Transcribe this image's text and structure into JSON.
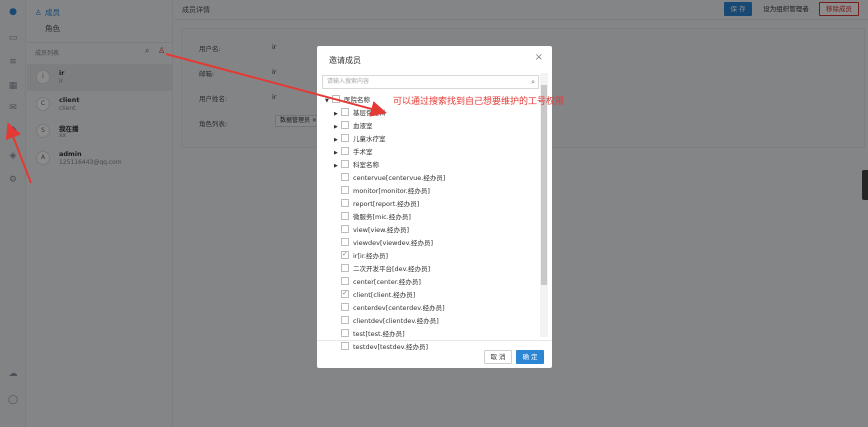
{
  "rail": {
    "icons": [
      "app-logo-icon",
      "monitor-icon",
      "list-icon",
      "grid-icon",
      "message-icon",
      "users-icon",
      "shield-icon",
      "gear-icon",
      "cloud-upload-icon",
      "user-icon"
    ]
  },
  "left": {
    "tabs": [
      {
        "label": "成员"
      },
      {
        "label": "角色"
      }
    ],
    "members_title": "成员列表",
    "members": [
      {
        "avatar": "i",
        "name": "ir",
        "sub": "ir"
      },
      {
        "avatar": "C",
        "name": "client",
        "sub": "client"
      },
      {
        "avatar": "S",
        "name": "我在播",
        "sub": "xx"
      },
      {
        "avatar": "A",
        "name": "admin",
        "sub": "125116443@qq.com"
      }
    ]
  },
  "main": {
    "title": "成员详情",
    "btn_save": "保 存",
    "btn_admin": "设为组织管理者",
    "btn_remove": "移除成员",
    "fields": [
      {
        "label": "用户名:",
        "value": "ir"
      },
      {
        "label": "邮箱:",
        "value": "ir"
      },
      {
        "label": "用户姓名:",
        "value": "ir"
      },
      {
        "label": "角色列表:",
        "value": ""
      }
    ],
    "role_tag": "数据管理员 ×"
  },
  "modal": {
    "title": "邀请成员",
    "search_placeholder": "请输入搜索内容",
    "root": "医院名称",
    "groups": [
      "基层保健科",
      "血液室",
      "儿童水疗室",
      "手术室",
      "科室名称"
    ],
    "items": [
      {
        "label": "centervue[centervue.经办员]",
        "checked": false
      },
      {
        "label": "monitor[monitor.经办员]",
        "checked": false
      },
      {
        "label": "report[report.经办员]",
        "checked": false
      },
      {
        "label": "微服务[mic.经办员]",
        "checked": false
      },
      {
        "label": "view[view.经办员]",
        "checked": false
      },
      {
        "label": "viewdev[viewdev.经办员]",
        "checked": false
      },
      {
        "label": "ir[ir.经办员]",
        "checked": true
      },
      {
        "label": "二次开发平台[dev.经办员]",
        "checked": false
      },
      {
        "label": "center[center.经办员]",
        "checked": false
      },
      {
        "label": "client[client.经办员]",
        "checked": true
      },
      {
        "label": "centerdev[centerdev.经办员]",
        "checked": false
      },
      {
        "label": "clientdev[clientdev.经办员]",
        "checked": false
      },
      {
        "label": "test[test.经办员]",
        "checked": false
      },
      {
        "label": "testdev[testdev.经办员]",
        "checked": false
      }
    ],
    "cancel": "取 消",
    "ok": "确 定"
  },
  "annotation": "可以通过搜索找到自己想要维护的工号权限",
  "colors": {
    "accent": "#2c86d3",
    "danger": "#d33333",
    "annotation": "#e53935"
  }
}
